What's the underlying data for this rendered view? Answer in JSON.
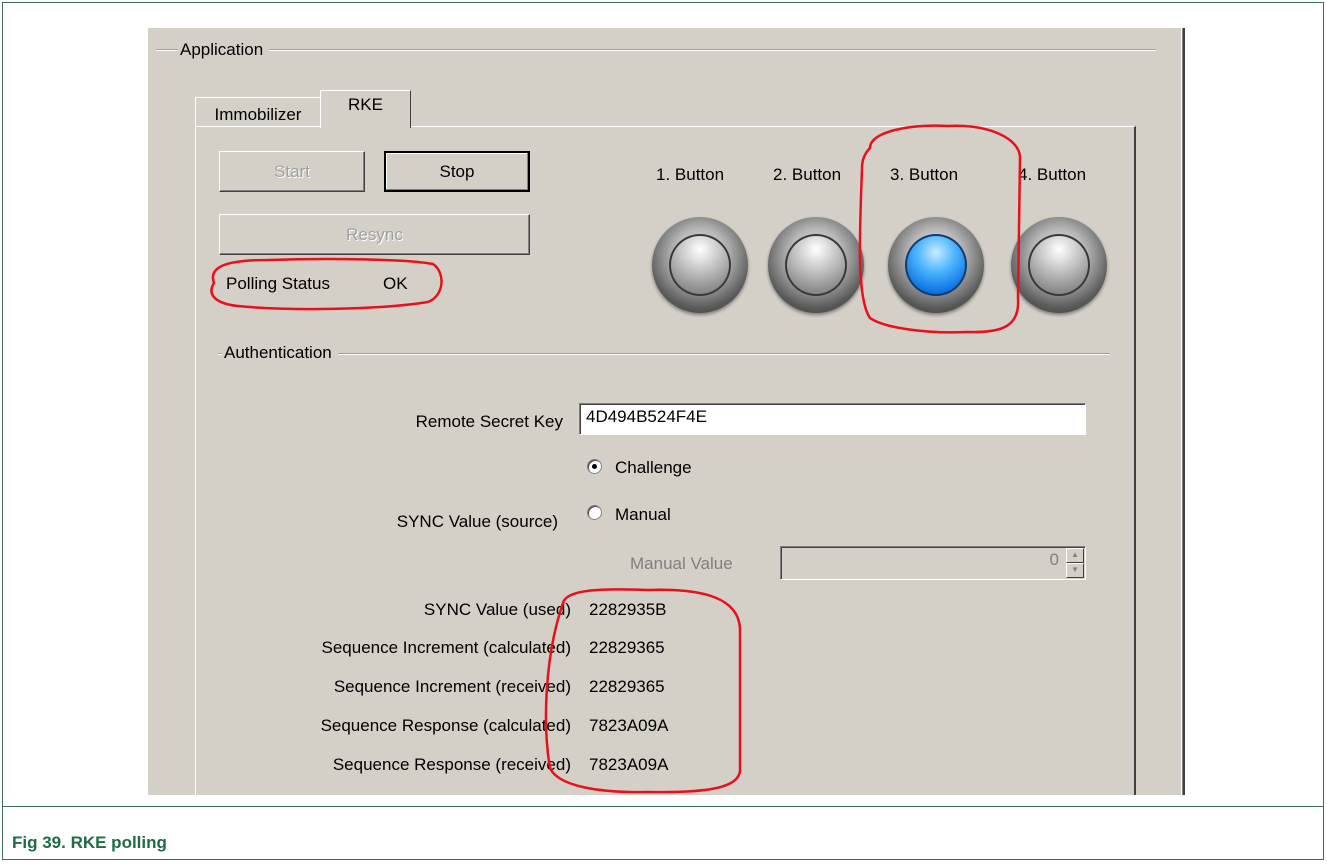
{
  "figure": {
    "caption": "Fig 39.   RKE polling"
  },
  "app": {
    "group_application": "Application",
    "tabs": [
      {
        "label": "Immobilizer",
        "active": false
      },
      {
        "label": "RKE",
        "active": true
      }
    ],
    "controls": {
      "start_label": "Start",
      "stop_label": "Stop",
      "resync_label": "Resync",
      "polling_status_label": "Polling Status",
      "polling_status_value": "OK"
    },
    "buttons": [
      {
        "label": "1. Button",
        "state": "off"
      },
      {
        "label": "2. Button",
        "state": "off"
      },
      {
        "label": "3. Button",
        "state": "on"
      },
      {
        "label": "4. Button",
        "state": "off"
      }
    ],
    "auth": {
      "group_label": "Authentication",
      "remote_secret_key_label": "Remote Secret Key",
      "remote_secret_key_value": "4D494B524F4E",
      "sync_source_label": "SYNC Value (source)",
      "radio_challenge": "Challenge",
      "radio_manual": "Manual",
      "selected_source": "Challenge",
      "manual_value_label": "Manual Value",
      "manual_value": "0"
    },
    "results": [
      {
        "label": "SYNC Value (used)",
        "value": "2282935B"
      },
      {
        "label": "Sequence Increment (calculated)",
        "value": "22829365"
      },
      {
        "label": "Sequence Increment (received)",
        "value": "22829365"
      },
      {
        "label": "Sequence Response (calculated)",
        "value": "7823A09A"
      },
      {
        "label": "Sequence Response (received)",
        "value": "7823A09A"
      }
    ],
    "colors": {
      "highlight": "#e8101c",
      "led_on": "#1a7fe8",
      "caption": "#1e6b45"
    }
  }
}
